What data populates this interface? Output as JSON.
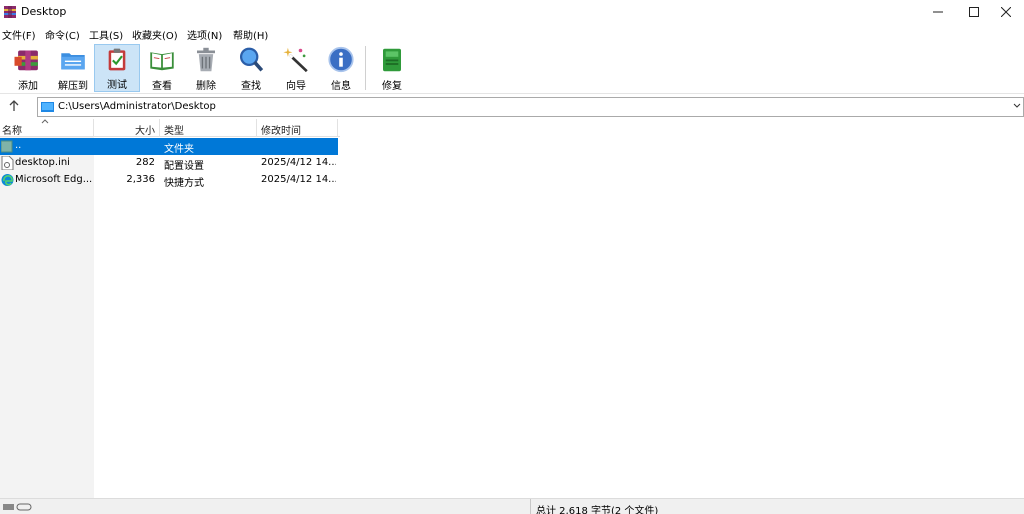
{
  "window": {
    "title": "Desktop",
    "app_icon": "winrar-icon",
    "controls": [
      "minimize-icon",
      "maximize-icon",
      "close-icon"
    ]
  },
  "menu": {
    "items": [
      "文件(F)",
      "命令(C)",
      "工具(S)",
      "收藏夹(O)",
      "选项(N)",
      "帮助(H)"
    ]
  },
  "toolbar": {
    "buttons": [
      {
        "label": "添加",
        "icon": "add-archive-icon"
      },
      {
        "label": "解压到",
        "icon": "extract-folder-icon"
      },
      {
        "label": "测试",
        "icon": "test-clipboard-icon",
        "active": true
      },
      {
        "label": "查看",
        "icon": "view-book-icon"
      },
      {
        "label": "删除",
        "icon": "trash-icon"
      },
      {
        "label": "查找",
        "icon": "find-magnifier-icon"
      },
      {
        "label": "向导",
        "icon": "wizard-wand-icon"
      },
      {
        "label": "信息",
        "icon": "info-icon"
      },
      {
        "label": "修复",
        "icon": "repair-icon"
      }
    ]
  },
  "address": {
    "path": "C:\\Users\\Administrator\\Desktop",
    "icon": "desktop-icon"
  },
  "columns": [
    "名称",
    "大小",
    "类型",
    "修改时间"
  ],
  "files": [
    {
      "name": "..",
      "size": "",
      "type": "文件夹",
      "modified": "",
      "icon": "folder-up-icon",
      "selected": true
    },
    {
      "name": "desktop.ini",
      "size": "282",
      "type": "配置设置",
      "modified": "2025/4/12 14...",
      "icon": "ini-file-icon",
      "selected": false
    },
    {
      "name": "Microsoft Edg...",
      "size": "2,336",
      "type": "快捷方式",
      "modified": "2025/4/12 14...",
      "icon": "edge-icon",
      "selected": false
    }
  ],
  "status": {
    "summary": "总计 2,618 字节(2 个文件)"
  },
  "colors": {
    "selection": "#0078d7",
    "sidebar": "#f3f3f3",
    "active_tool": "#cce4f7"
  }
}
